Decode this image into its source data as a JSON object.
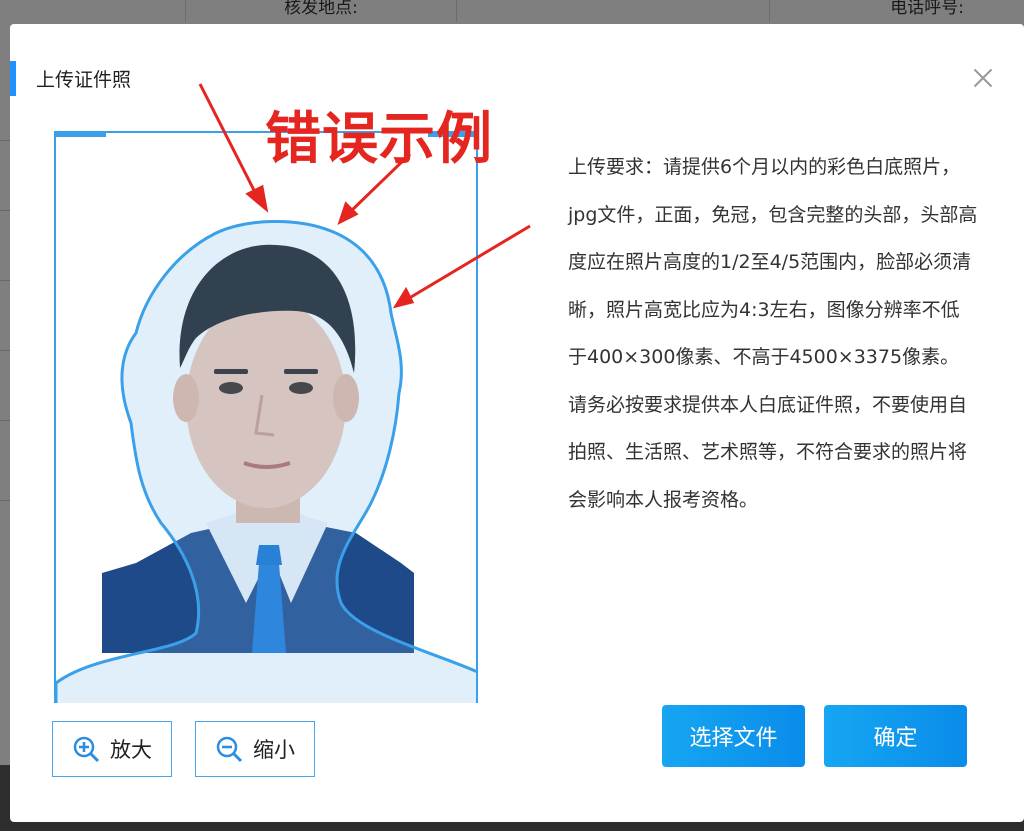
{
  "background": {
    "header_cells": [
      "核发地点:",
      "电话呼号:"
    ]
  },
  "modal": {
    "title": "上传证件照",
    "example_tag": "错误示例",
    "requirements": "上传要求：请提供6个月以内的彩色白底照片，jpg文件，正面，免冠，包含完整的头部，头部高度应在照片高度的1/2至4/5范围内，脸部必须清晰，照片高宽比应为4:3左右，图像分辨率不低于400×300像素、不高于4500×3375像素。请务必按要求提供本人白底证件照，不要使用自拍照、生活照、艺术照等，不符合要求的照片将会影响本人报考资格。",
    "zoom_in_label": "放大",
    "zoom_out_label": "缩小",
    "choose_file_label": "选择文件",
    "confirm_label": "确定"
  },
  "colors": {
    "accent": "#1e90ff",
    "frame": "#3aa0ea",
    "warning_text": "#e52520"
  }
}
